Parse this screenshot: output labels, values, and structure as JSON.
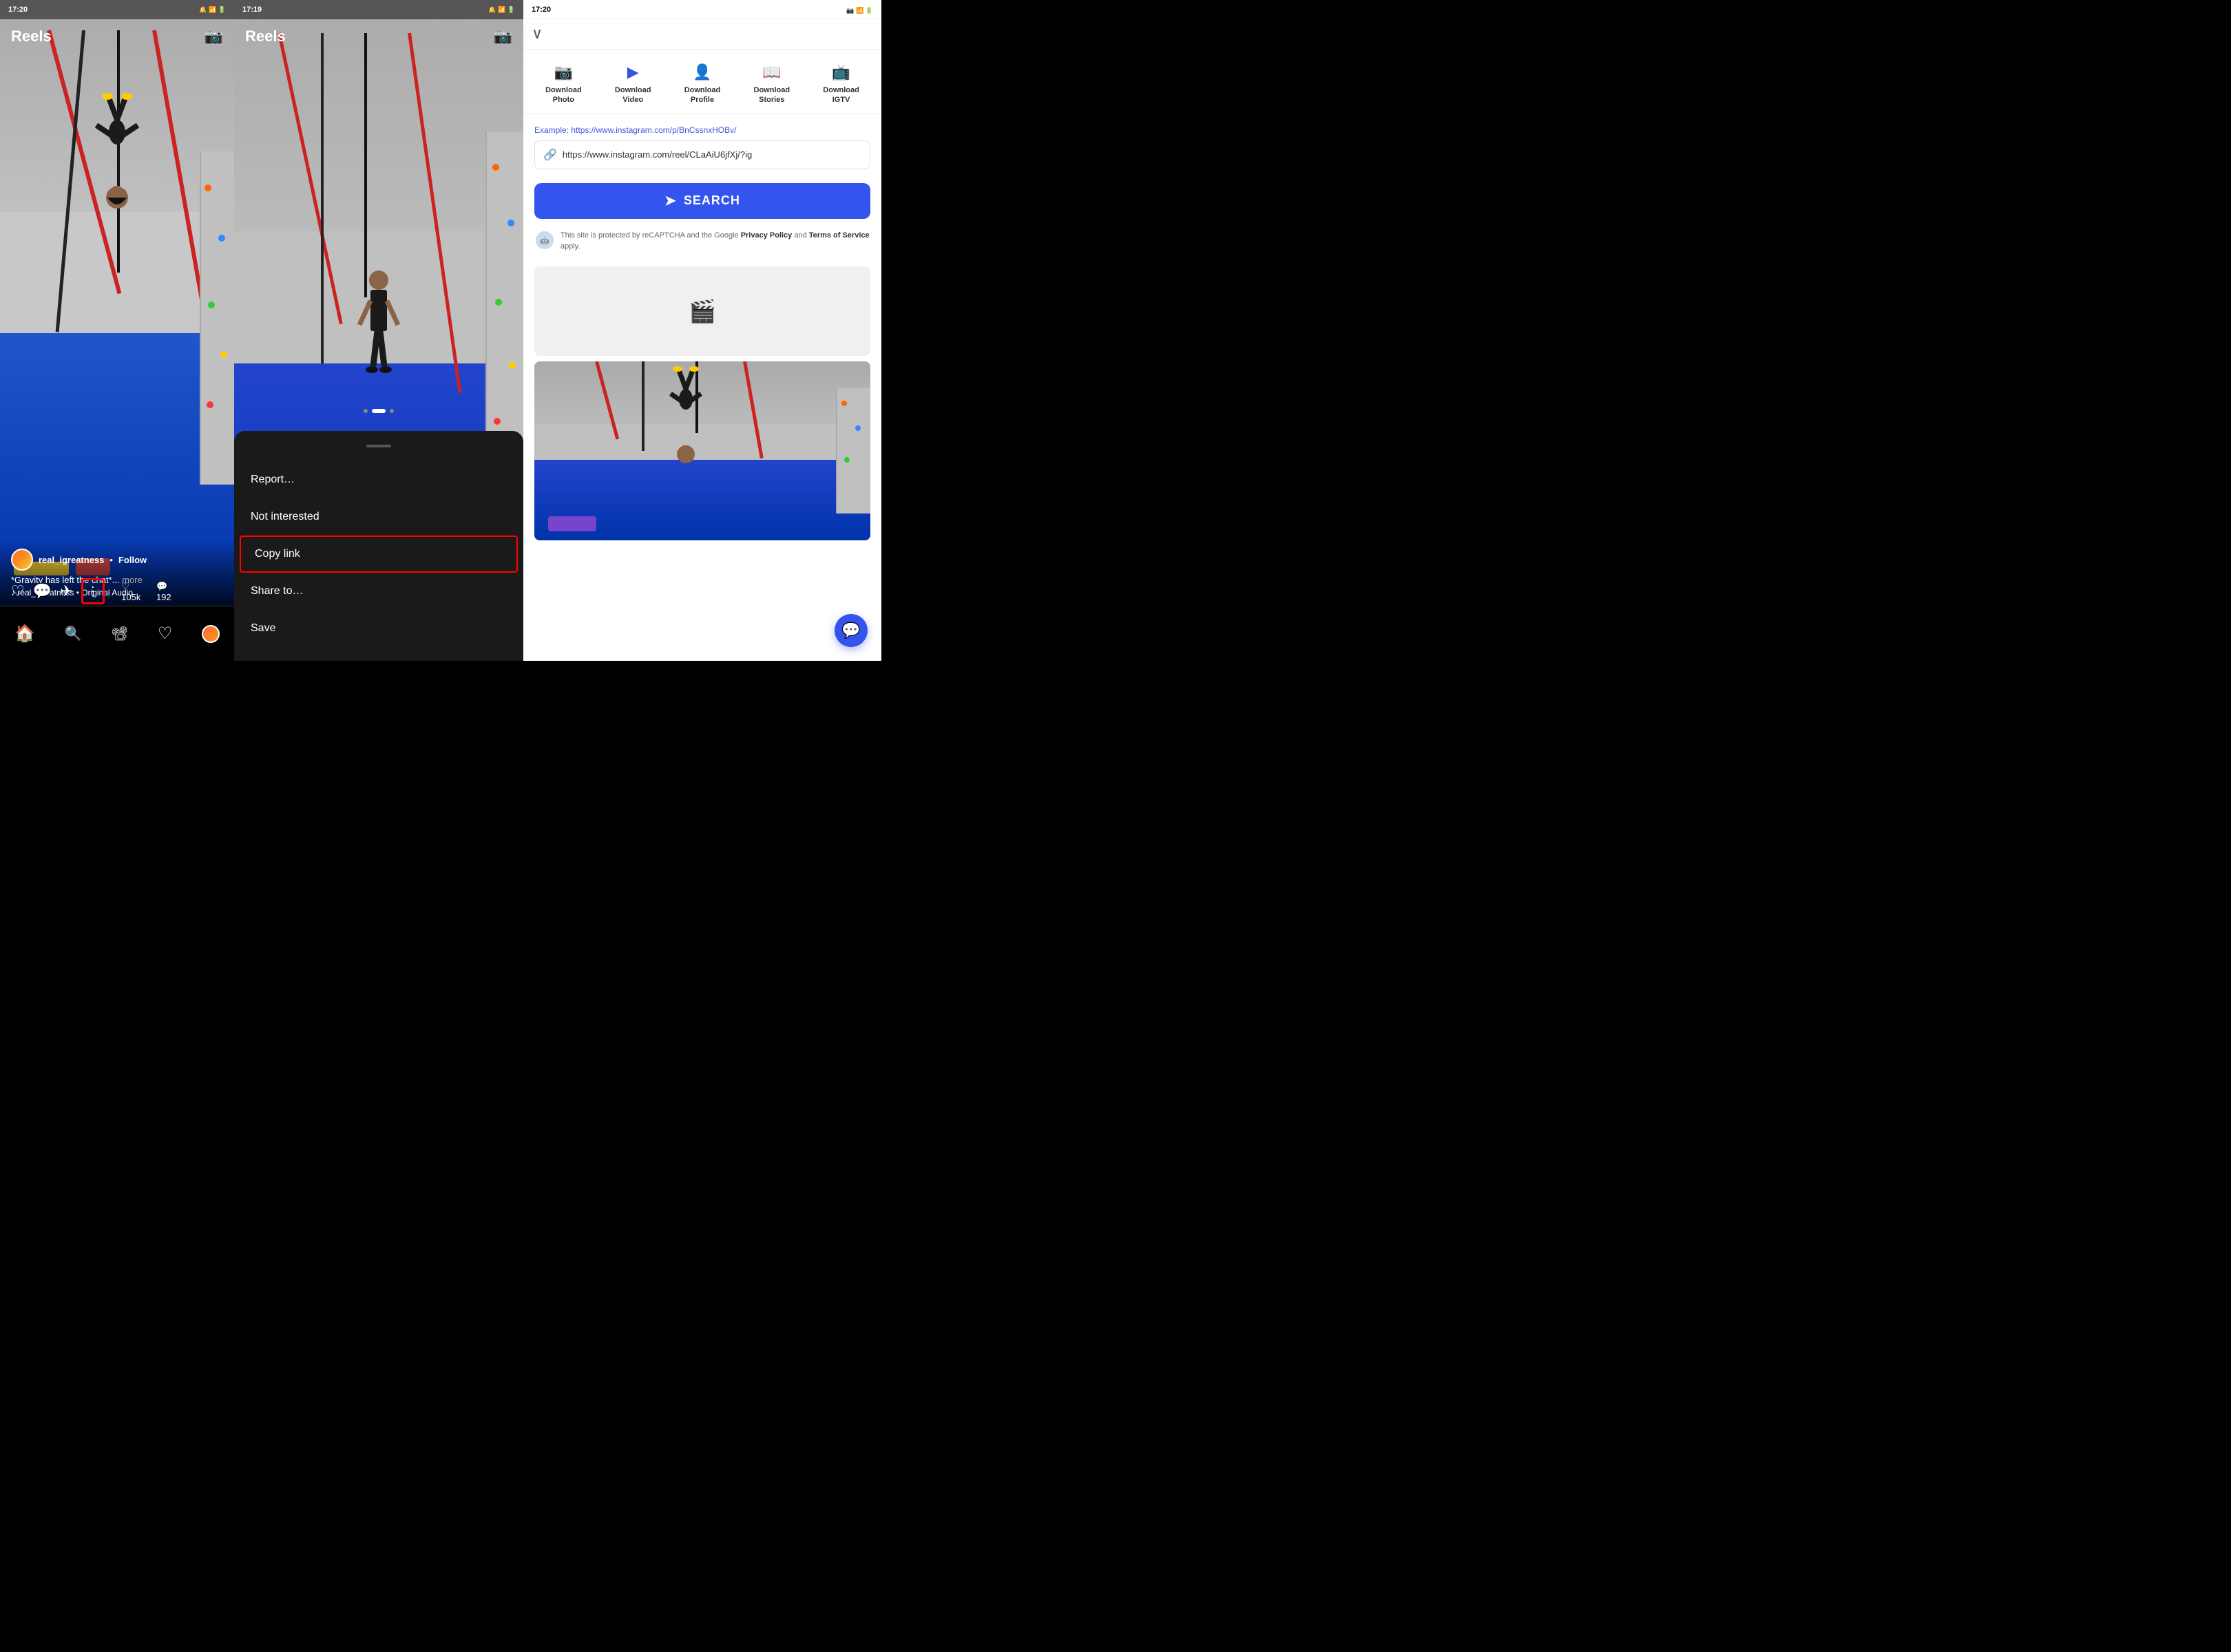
{
  "panels": {
    "panel1": {
      "statusBar": {
        "time": "17:20",
        "icons": "📷 M ◆ •"
      },
      "title": "Reels",
      "camera_label": "camera",
      "user": {
        "name": "real_igreatness",
        "follow": "Follow",
        "caption": "*Gravity has left the chat*...",
        "more": "more",
        "audio": "♪ real_igreatness • Original Audio"
      },
      "stats": {
        "likes": "105k",
        "comments": "192"
      },
      "nav": {
        "home": "⌂",
        "search": "🔍",
        "reels": "⬡",
        "heart": "♡"
      }
    },
    "panel2": {
      "statusBar": {
        "time": "17:19",
        "icons": "M ◆ ✦ •"
      },
      "title": "Reels",
      "menu": {
        "items": [
          {
            "label": "Report…",
            "highlighted": false
          },
          {
            "label": "Not interested",
            "highlighted": false
          },
          {
            "label": "Copy link",
            "highlighted": true
          },
          {
            "label": "Share to…",
            "highlighted": false
          },
          {
            "label": "Save",
            "highlighted": false
          }
        ]
      }
    },
    "panel3": {
      "statusBar": {
        "time": "17:20",
        "icons": "📷 M ◆ •"
      },
      "backBtn": "∨",
      "tabs": [
        {
          "icon": "📷",
          "label": "Download\nPhoto"
        },
        {
          "icon": "▶",
          "label": "Download\nVideo"
        },
        {
          "icon": "👤",
          "label": "Download\nProfile"
        },
        {
          "icon": "📖",
          "label": "Download\nStories"
        },
        {
          "icon": "📺",
          "label": "Download\nIGTV"
        }
      ],
      "example": {
        "prefix": "Example:",
        "url": "https://www.instagram.com/p/BnCssnxHOBv/"
      },
      "inputUrl": "https://www.instagram.com/reel/CLaAiU6jfXj/?ig",
      "searchBtn": "SEARCH",
      "recaptcha": {
        "text1": "This site is protected by reCAPTCHA and the Google ",
        "link1": "Privacy Policy",
        "text2": " and ",
        "link2": "Terms of Service",
        "text3": " apply."
      }
    }
  }
}
